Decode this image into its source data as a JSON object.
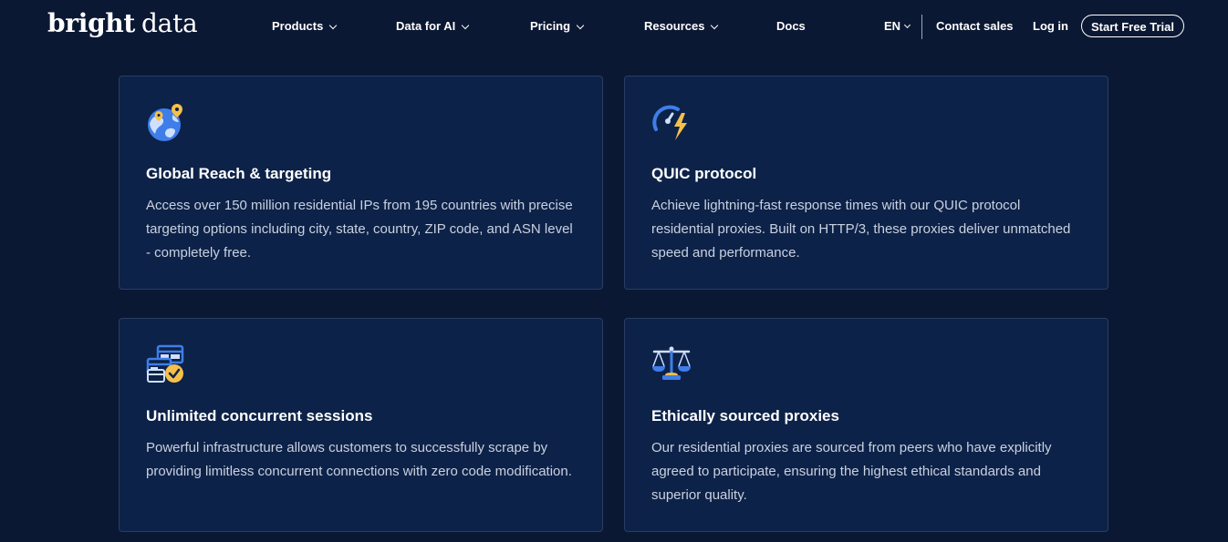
{
  "header": {
    "logo_bold": "bright",
    "logo_light": "data",
    "nav": [
      {
        "label": "Products"
      },
      {
        "label": "Data for AI"
      },
      {
        "label": "Pricing"
      },
      {
        "label": "Resources"
      },
      {
        "label": "Docs"
      }
    ],
    "language": "EN",
    "contact_sales": "Contact sales",
    "login": "Log in",
    "trial_button": "Start Free Trial"
  },
  "features": [
    {
      "icon": "globe-pin-icon",
      "title": "Global Reach & targeting",
      "description": "Access over 150 million residential IPs from 195 countries with precise targeting options including city, state, country, ZIP code, and ASN level - completely free."
    },
    {
      "icon": "speedometer-lightning-icon",
      "title": "QUIC protocol",
      "description": "Achieve lightning-fast response times with our QUIC protocol residential proxies. Built on HTTP/3, these proxies deliver unmatched speed and performance."
    },
    {
      "icon": "browser-windows-check-icon",
      "title": "Unlimited concurrent sessions",
      "description": "Powerful infrastructure allows customers to successfully scrape by providing limitless concurrent connections with zero code modification."
    },
    {
      "icon": "scales-icon",
      "title": "Ethically sourced proxies",
      "description": "Our residential proxies are sourced from peers who have explicitly agreed to participate, ensuring the highest ethical standards and superior quality."
    }
  ],
  "colors": {
    "background": "#0b1833",
    "card": "#0d2248",
    "accent_blue": "#3f7ee8",
    "accent_yellow": "#f5c04a"
  }
}
